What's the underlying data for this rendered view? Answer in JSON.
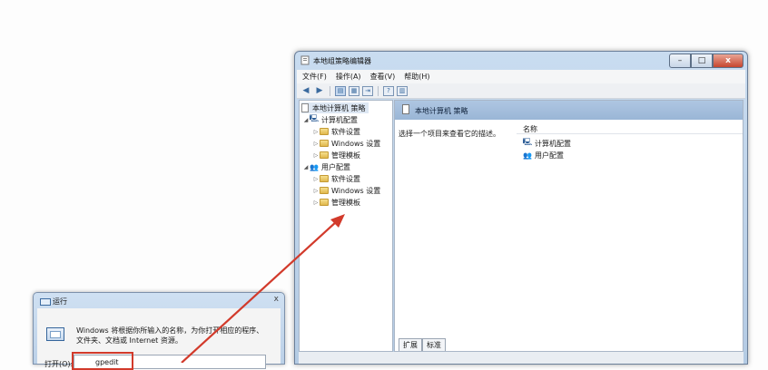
{
  "gp_window": {
    "title": "本地组策略编辑器",
    "buttons": {
      "minimize": "–",
      "maximize": "□",
      "close": "x"
    },
    "menu": [
      "文件(F)",
      "操作(A)",
      "查看(V)",
      "帮助(H)"
    ],
    "tree": {
      "root": "本地计算机 策略",
      "computer_config": "计算机配置",
      "computer_children": [
        "软件设置",
        "Windows 设置",
        "管理模板"
      ],
      "user_config": "用户配置",
      "user_children": [
        "软件设置",
        "Windows 设置",
        "管理模板"
      ]
    },
    "right_pane": {
      "header": "本地计算机 策略",
      "description": "选择一个项目来查看它的描述。",
      "column_name": "名称",
      "items": [
        "计算机配置",
        "用户配置"
      ],
      "tabs": [
        "扩展",
        "标准"
      ]
    }
  },
  "run_dialog": {
    "title": "运行",
    "close": "x",
    "description_line1": "Windows 将根据你所输入的名称，为你打开相应的程序、",
    "description_line2": "文件夹、文档或 Internet 资源。",
    "open_label": "打开(O):",
    "input_value": "gpedit"
  },
  "colors": {
    "arrow": "#d23a2b",
    "header_blue": "#9ab6d6",
    "window_frame": "#b4cbe4"
  }
}
